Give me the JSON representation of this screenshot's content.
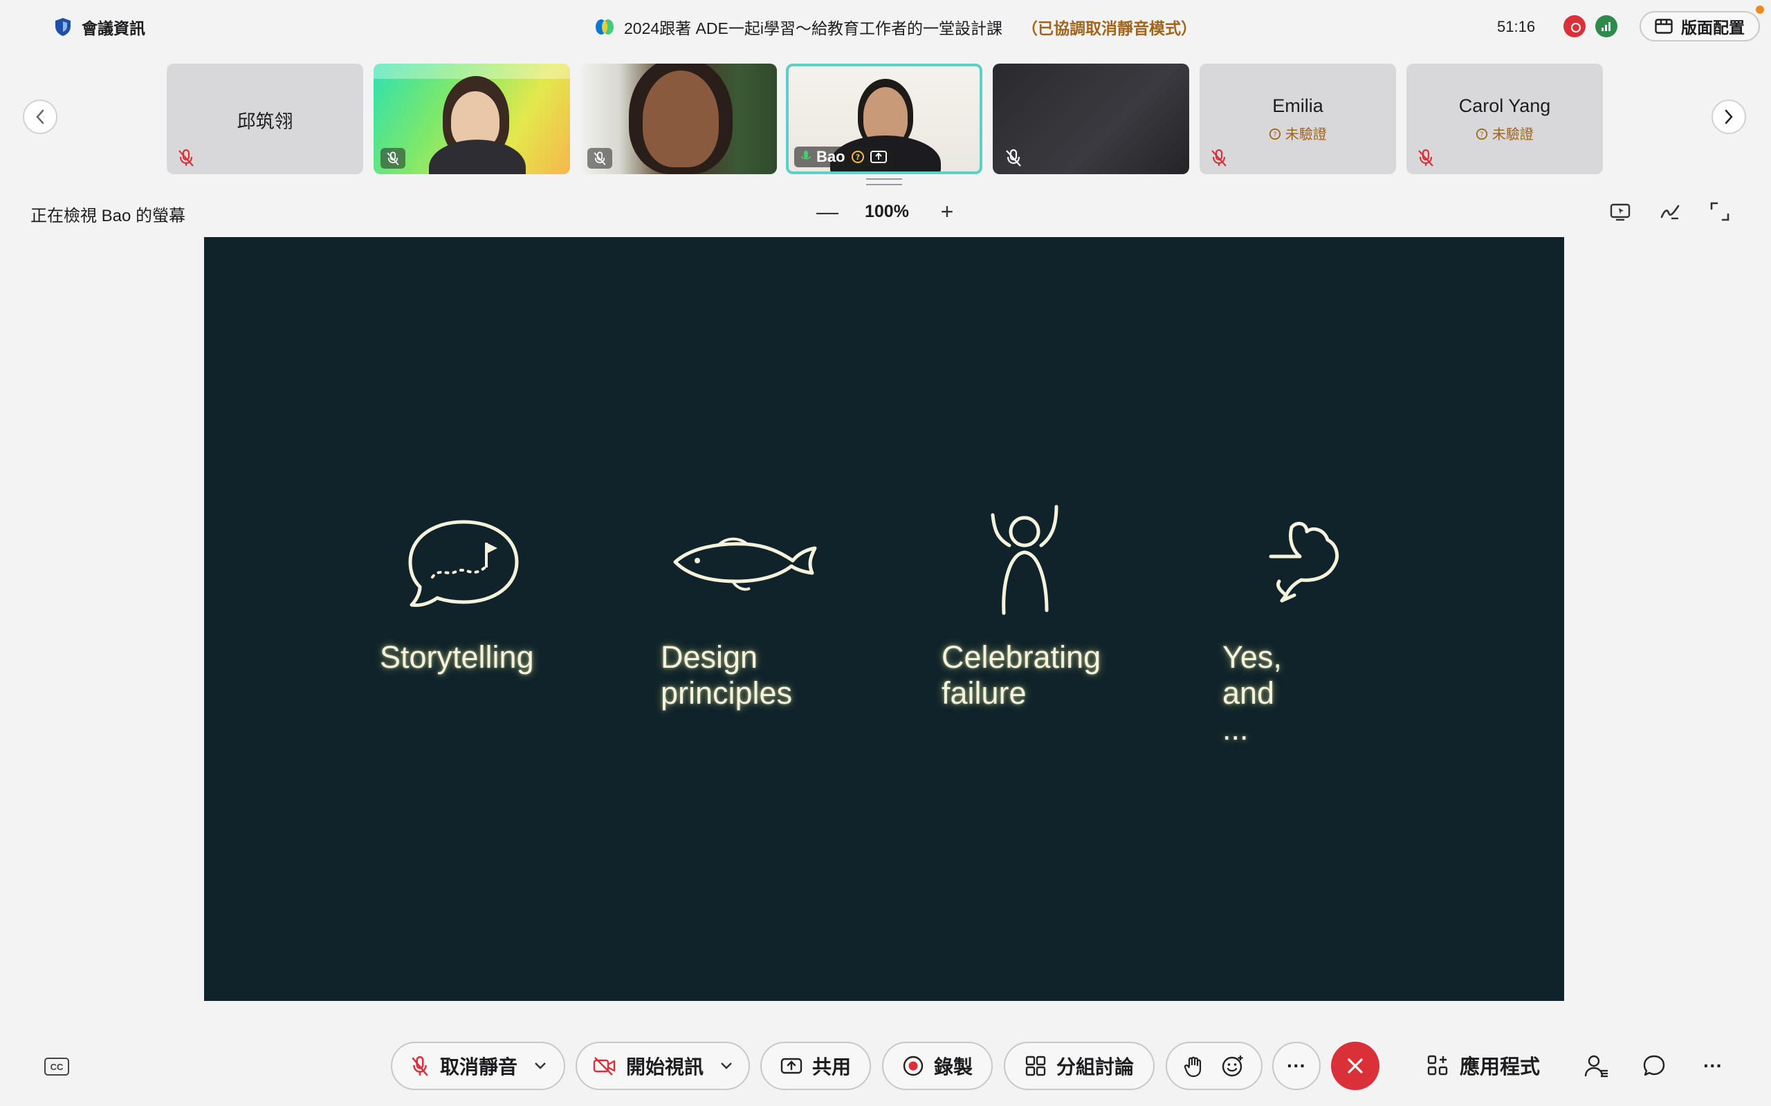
{
  "titlebar": {
    "meeting_info_label": "會議資訊",
    "meeting_title": "2024跟著 ADE一起i學習～給教育工作者的一堂設計課",
    "meeting_note": "（已協調取消靜音模式）",
    "timer": "51:16",
    "layout_button": "版面配置"
  },
  "filmstrip": {
    "participants": [
      {
        "name": "邱筑翎",
        "sub": "",
        "video": false,
        "muted": true
      },
      {
        "name": "",
        "sub": "",
        "video": true,
        "muted": true
      },
      {
        "name": "",
        "sub": "",
        "video": true,
        "muted": true
      },
      {
        "name": "Bao",
        "sub": "",
        "video": true,
        "muted": false,
        "active": true
      },
      {
        "name": "",
        "sub": "",
        "video": true,
        "muted": true
      },
      {
        "name": "Emilia",
        "sub": "未驗證",
        "video": false,
        "muted": true
      },
      {
        "name": "Carol Yang",
        "sub": "未驗證",
        "video": false,
        "muted": true
      }
    ]
  },
  "viewbar": {
    "viewing_label": "正在檢視 Bao 的螢幕",
    "zoom_minus": "—",
    "zoom_level": "100%",
    "zoom_plus": "+"
  },
  "slide": {
    "items": [
      {
        "label": "Storytelling",
        "icon": "speech-bubble-path-flag-icon"
      },
      {
        "label": "Design\nprinciples",
        "icon": "fish-icon"
      },
      {
        "label": "Celebrating\nfailure",
        "icon": "arms-raised-person-icon"
      },
      {
        "label": "Yes, and ...",
        "icon": "pointing-hand-icon"
      }
    ]
  },
  "controls": {
    "cc_label": "CC",
    "unmute": "取消靜音",
    "start_video": "開始視訊",
    "share": "共用",
    "record": "錄製",
    "breakout": "分組討論",
    "more": "···",
    "apps": "應用程式",
    "more_right": "···"
  },
  "colors": {
    "slide_background": "#10232a",
    "slide_text": "#f6f3dc",
    "leave_red": "#d93039",
    "active_border": "#5ad0c8",
    "warning_text": "#a0641a"
  }
}
